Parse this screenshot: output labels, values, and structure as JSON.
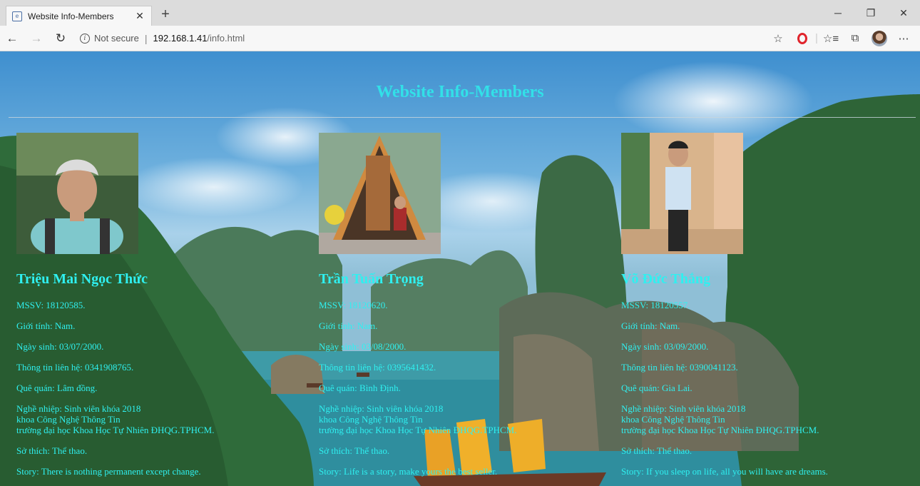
{
  "browser": {
    "tab_title": "Website Info-Members",
    "security_text": "Not secure",
    "url_host": "192.168.1.41",
    "url_path": "/info.html"
  },
  "page": {
    "title": "Website Info-Members"
  },
  "members": [
    {
      "name": "Triệu Mai Ngọc Thức",
      "mssv": "MSSV: 18120585.",
      "gender": "Giới tính: Nam.",
      "dob": "Ngày sinh: 03/07/2000.",
      "contact": "Thông tin liên hệ: 0341908765.",
      "hometown": "Quê quán: Lâm đồng.",
      "job_1": "Nghề nhiệp: Sinh viên khóa 2018",
      "job_2": "khoa Công Nghệ Thông Tin",
      "job_3": "trường đại học Khoa Học Tự Nhiên ĐHQG.TPHCM.",
      "hobby": "Sở thích: Thể thao.",
      "story": "Story: There is nothing permanent except change."
    },
    {
      "name": "Trần Tuấn Trọng",
      "mssv": "MSSV: 18120620.",
      "gender": "Giới tính: Nam.",
      "dob": "Ngày sinh: 03/08/2000.",
      "contact": "Thông tin liên hệ: 0395641432.",
      "hometown": "Quê quán: Bình Định.",
      "job_1": "Nghề nhiệp: Sinh viên khóa 2018",
      "job_2": "khoa Công Nghệ Thông Tin",
      "job_3": "trường đại học Khoa Học Tự Nhiên ĐHQG.TPHCM.",
      "hobby": "Sở thích: Thể thao.",
      "story": "Story: Life is a story, make yours the best seller."
    },
    {
      "name": "Võ Đức Thắng",
      "mssv": "MSSV: 18120557.",
      "gender": "Giới tính: Nam.",
      "dob": "Ngày sinh: 03/09/2000.",
      "contact": "Thông tin liên hệ: 0390041123.",
      "hometown": "Quê quán: Gia Lai.",
      "job_1": "Nghề nhiệp: Sinh viên khóa 2018",
      "job_2": "khoa Công Nghệ Thông Tin",
      "job_3": "trường đại học Khoa Học Tự Nhiên ĐHQG.TPHCM.",
      "hobby": "Sở thích: Thể thao.",
      "story": "Story: If you sleep on life, all you will have are dreams."
    }
  ],
  "icons": {
    "back": "arrow-left-icon",
    "forward": "arrow-right-icon",
    "refresh": "refresh-icon",
    "info": "info-icon",
    "favorite": "star-icon",
    "opera": "opera-icon",
    "favorites_list": "favorites-list-icon",
    "collections": "collections-icon",
    "profile": "avatar-icon",
    "more": "more-icon"
  },
  "colors": {
    "title": "#32e0e8",
    "member_text": "#2ff0f0",
    "sky": "#6fb1de",
    "water": "#2f8e9e",
    "mountain": "#2f6b3a"
  }
}
